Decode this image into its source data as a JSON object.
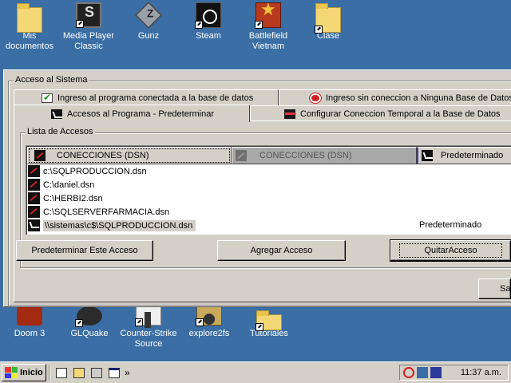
{
  "desktop": {
    "top_icons": [
      {
        "label": "Mis documentos"
      },
      {
        "label": "Media Player Classic"
      },
      {
        "label": "Gunz"
      },
      {
        "label": "Steam"
      },
      {
        "label": "Battlefield Vietnam"
      },
      {
        "label": "Clase"
      }
    ],
    "bottom_icons": [
      {
        "label": "Doom 3"
      },
      {
        "label": "GLQuake"
      },
      {
        "label": "Counter-Strike Source"
      },
      {
        "label": "explore2fs"
      },
      {
        "label": "Tutoriales"
      }
    ]
  },
  "dialog": {
    "group_title": "Acceso al Sistema",
    "tabs": [
      {
        "label": "Ingreso al programa conectada a la base de datos",
        "icon": "check-icon"
      },
      {
        "label": "Ingreso sin coneccion a Ninguna Base de Datos",
        "icon": "no-connection-icon"
      },
      {
        "label": "Accesos al Programa - Predeterminar",
        "icon": "default-icon",
        "active": true
      },
      {
        "label": "Configurar Coneccion Temporal a la Base de Datos",
        "icon": "temp-connection-icon"
      }
    ],
    "list_group_title": "Lista de Accesos",
    "list": {
      "columns": [
        "CONECCIONES (DSN)",
        "CONECCIONES (DSN)",
        "Predeterminado"
      ],
      "rows": [
        {
          "dsn": "c:\\SQLPRODUCCION.dsn",
          "default": ""
        },
        {
          "dsn": "C:\\daniel.dsn",
          "default": ""
        },
        {
          "dsn": "C:\\HERBI2.dsn",
          "default": ""
        },
        {
          "dsn": "C:\\SQLSERVERFARMACIA.dsn",
          "default": ""
        },
        {
          "dsn": "\\\\sistemas\\c$\\SQLPRODUCCION.dsn",
          "default": "Predeterminado",
          "selected": true
        }
      ]
    },
    "buttons": {
      "set_default": "Predeterminar Este Acceso",
      "add": "Agregar Acceso",
      "remove": "QuitarAcceso",
      "exit": "Sa"
    }
  },
  "taskbar": {
    "start_label": "Inicio",
    "more": "»",
    "clock": "11:37 a.m."
  }
}
